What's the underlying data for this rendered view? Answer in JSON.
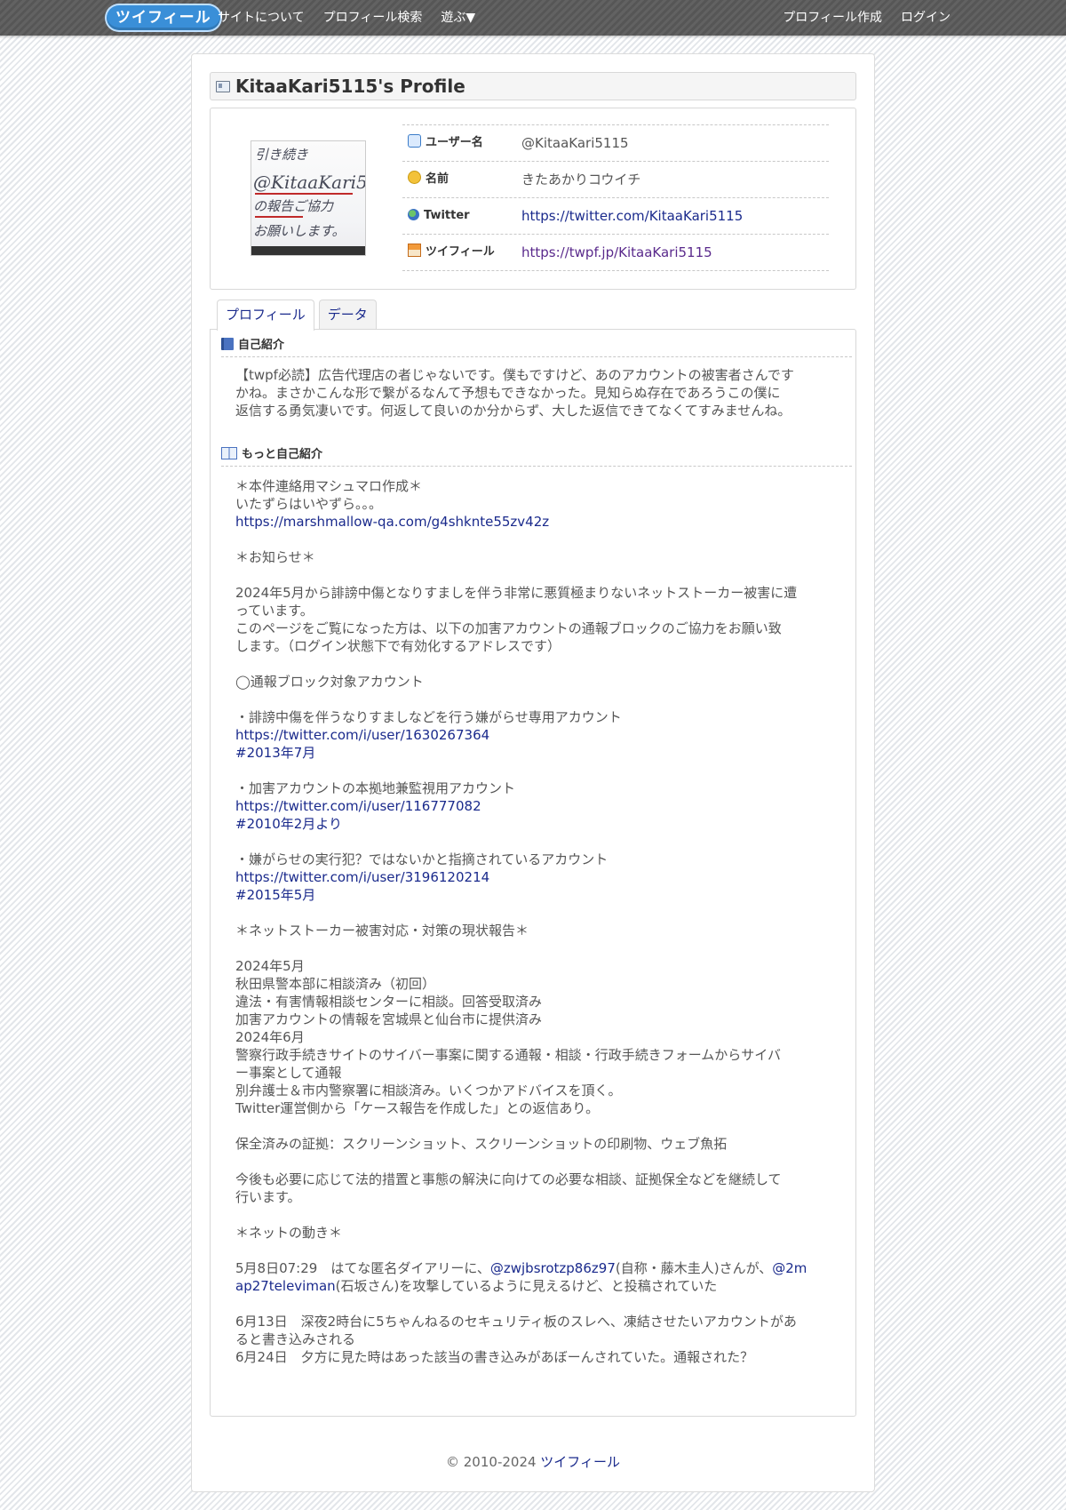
{
  "nav": {
    "logo": "ツイフィール",
    "left": [
      "サイトについて",
      "プロフィール検索",
      "遊ぶ▼"
    ],
    "right": [
      "プロフィール作成",
      "ログイン"
    ]
  },
  "profile": {
    "title": "KitaaKari5115's Profile",
    "avatar_lines": [
      "引き続き",
      "@KitaaKari5",
      "の報告ご協力",
      "お願いします。"
    ],
    "rows": [
      {
        "icon": "speech-bubble-icon",
        "label": "ユーザー名",
        "value": "@KitaaKari5115",
        "link": false
      },
      {
        "icon": "smiley-icon",
        "label": "名前",
        "value": "きたあかりコウイチ",
        "link": false
      },
      {
        "icon": "globe-icon",
        "label": "Twitter",
        "value": "https://twitter.com/KitaaKari5115",
        "link": true
      },
      {
        "icon": "house-icon",
        "label": "ツイフィール",
        "value": "https://twpf.jp/KitaaKari5115",
        "link": true
      }
    ]
  },
  "tabs": [
    "プロフィール",
    "データ"
  ],
  "intro": {
    "heading": "自己紹介",
    "lines": [
      "【twpf必読】広告代理店の者じゃないです。僕もですけど、あのアカウントの被害者さんです",
      "かね。まさかこんな形で繋がるなんて予想もできなかった。見知らぬ存在であろうこの僕に",
      "返信する勇気凄いです。何返して良いのか分からず、大した返信できてなくてすみませんね。"
    ]
  },
  "more": {
    "heading": "もっと自己紹介",
    "lines": [
      [
        {
          "t": "＊本件連絡用マシュマロ作成＊"
        }
      ],
      [
        {
          "t": "いたずらはいやずら。。。"
        }
      ],
      [
        {
          "t": "https://marshmallow-qa.com/g4shknte55zv42z",
          "link": true
        }
      ],
      [],
      [
        {
          "t": "＊お知らせ＊"
        }
      ],
      [],
      [
        {
          "t": "2024年5月から誹謗中傷となりすましを伴う非常に悪質極まりないネットストーカー被害に遭"
        }
      ],
      [
        {
          "t": "っています。"
        }
      ],
      [
        {
          "t": "このページをご覧になった方は、以下の加害アカウントの通報ブロックのご協力をお願い致"
        }
      ],
      [
        {
          "t": "します。（ログイン状態下で有効化するアドレスです）"
        }
      ],
      [],
      [
        {
          "t": "◯通報ブロック対象アカウント"
        }
      ],
      [],
      [
        {
          "t": "・誹謗中傷を伴うなりすましなどを行う嫌がらせ専用アカウント"
        }
      ],
      [
        {
          "t": "https://twitter.com/i/user/1630267364",
          "link": true
        }
      ],
      [
        {
          "t": "#2013年7月",
          "link": true
        }
      ],
      [],
      [
        {
          "t": "・加害アカウントの本拠地兼監視用アカウント"
        }
      ],
      [
        {
          "t": "https://twitter.com/i/user/116777082",
          "link": true
        }
      ],
      [
        {
          "t": "#2010年2月より",
          "link": true
        }
      ],
      [],
      [
        {
          "t": "・嫌がらせの実行犯？ではないかと指摘されているアカウント"
        }
      ],
      [
        {
          "t": "https://twitter.com/i/user/3196120214",
          "link": true
        }
      ],
      [
        {
          "t": "#2015年5月",
          "link": true
        }
      ],
      [],
      [
        {
          "t": "＊ネットストーカー被害対応・対策の現状報告＊"
        }
      ],
      [],
      [
        {
          "t": "2024年5月"
        }
      ],
      [
        {
          "t": "秋田県警本部に相談済み（初回）"
        }
      ],
      [
        {
          "t": "違法・有害情報相談センターに相談。回答受取済み"
        }
      ],
      [
        {
          "t": "加害アカウントの情報を宮城県と仙台市に提供済み"
        }
      ],
      [
        {
          "t": "2024年6月"
        }
      ],
      [
        {
          "t": "警察行政手続きサイトのサイバー事案に関する通報・相談・行政手続きフォームからサイバ"
        }
      ],
      [
        {
          "t": "ー事案として通報"
        }
      ],
      [
        {
          "t": "別弁護士＆市内警察署に相談済み。いくつかアドバイスを頂く。"
        }
      ],
      [
        {
          "t": "Twitter運営側から「ケース報告を作成した」との返信あり。"
        }
      ],
      [],
      [
        {
          "t": "保全済みの証拠：スクリーンショット、スクリーンショットの印刷物、ウェブ魚拓"
        }
      ],
      [],
      [
        {
          "t": "今後も必要に応じて法的措置と事態の解決に向けての必要な相談、証拠保全などを継続して"
        }
      ],
      [
        {
          "t": "行います。"
        }
      ],
      [],
      [
        {
          "t": "＊ネットの動き＊"
        }
      ],
      [],
      [
        {
          "t": "5月8日07:29　はてな匿名ダイアリーに、"
        },
        {
          "t": "@zwjbsrotzp86z97",
          "link": true
        },
        {
          "t": "(自称・藤木圭人)さんが、"
        },
        {
          "t": "@2m",
          "link": true
        }
      ],
      [
        {
          "t": "ap27televiman",
          "link": true
        },
        {
          "t": "(石坂さん)を攻撃しているように見えるけど、と投稿されていた"
        }
      ],
      [],
      [
        {
          "t": "6月13日　深夜2時台に5ちゃんねるのセキュリティ板のスレへ、凍結させたいアカウントがあ"
        }
      ],
      [
        {
          "t": "ると書き込みされる"
        }
      ],
      [
        {
          "t": "6月24日　夕方に見た時はあった該当の書き込みがあぼーんされていた。通報された？"
        }
      ]
    ]
  },
  "footer": {
    "copyright": "© 2010-2024 ",
    "site": "ツイフィール"
  },
  "colors": {
    "link": "#1a2a8c",
    "topbar": "#5a5a5a",
    "text": "#555555"
  }
}
